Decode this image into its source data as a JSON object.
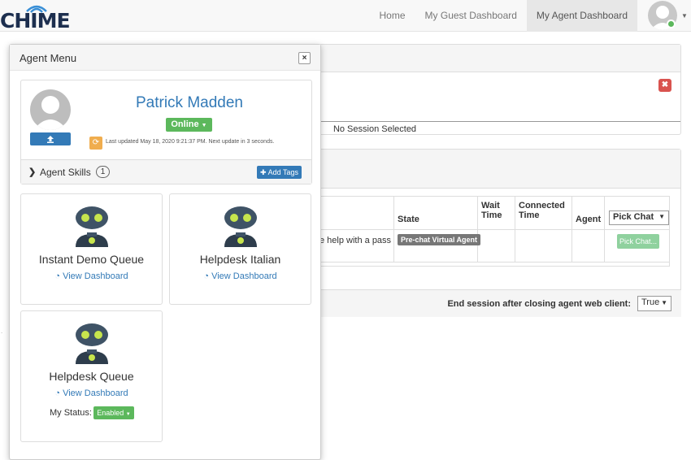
{
  "brand": {
    "logo_text": "CHIME"
  },
  "nav": {
    "links": [
      {
        "label": "Home"
      },
      {
        "label": "My Guest Dashboard"
      },
      {
        "label": "My Agent Dashboard",
        "active": true
      }
    ]
  },
  "session_panel": {
    "no_session_text": "No Session Selected"
  },
  "chats_table": {
    "headers": {
      "state": "State",
      "wait_time": "Wait Time",
      "connected_time": "Connected Time",
      "agent": "Agent"
    },
    "pick_chat_select": "Pick Chat",
    "row": {
      "question_fragment": "e help with a pass",
      "state": "Pre-chat Virtual Agent",
      "pick_button": "Pick Chat..."
    }
  },
  "session_settings": {
    "end_session_label": "End session after closing agent web client:",
    "end_session_value": "True"
  },
  "agent_menu": {
    "title": "Agent Menu",
    "close_glyph": "×",
    "agent_name": "Patrick Madden",
    "status": "Online",
    "last_updated": "Last updated May 18, 2020 9:21:37 PM. Next update in 3 seconds.",
    "skills_label": "Agent Skills",
    "skills_count": "1",
    "add_tags_label": "Add Tags",
    "queues": [
      {
        "name": "Instant Demo Queue",
        "link": "View Dashboard"
      },
      {
        "name": "Helpdesk Italian",
        "link": "View Dashboard"
      },
      {
        "name": "Helpdesk Queue",
        "link": "View Dashboard",
        "status_label": "My Status:",
        "status_value": "Enabled"
      }
    ]
  },
  "colors": {
    "primary": "#337ab7",
    "success": "#5cb85c",
    "danger": "#d9534f",
    "warning": "#f0ad4e"
  },
  "icons": {
    "dismiss_red": "times-icon",
    "refresh": "refresh-icon",
    "upload": "upload-icon",
    "dashboard": "tachometer-icon"
  }
}
